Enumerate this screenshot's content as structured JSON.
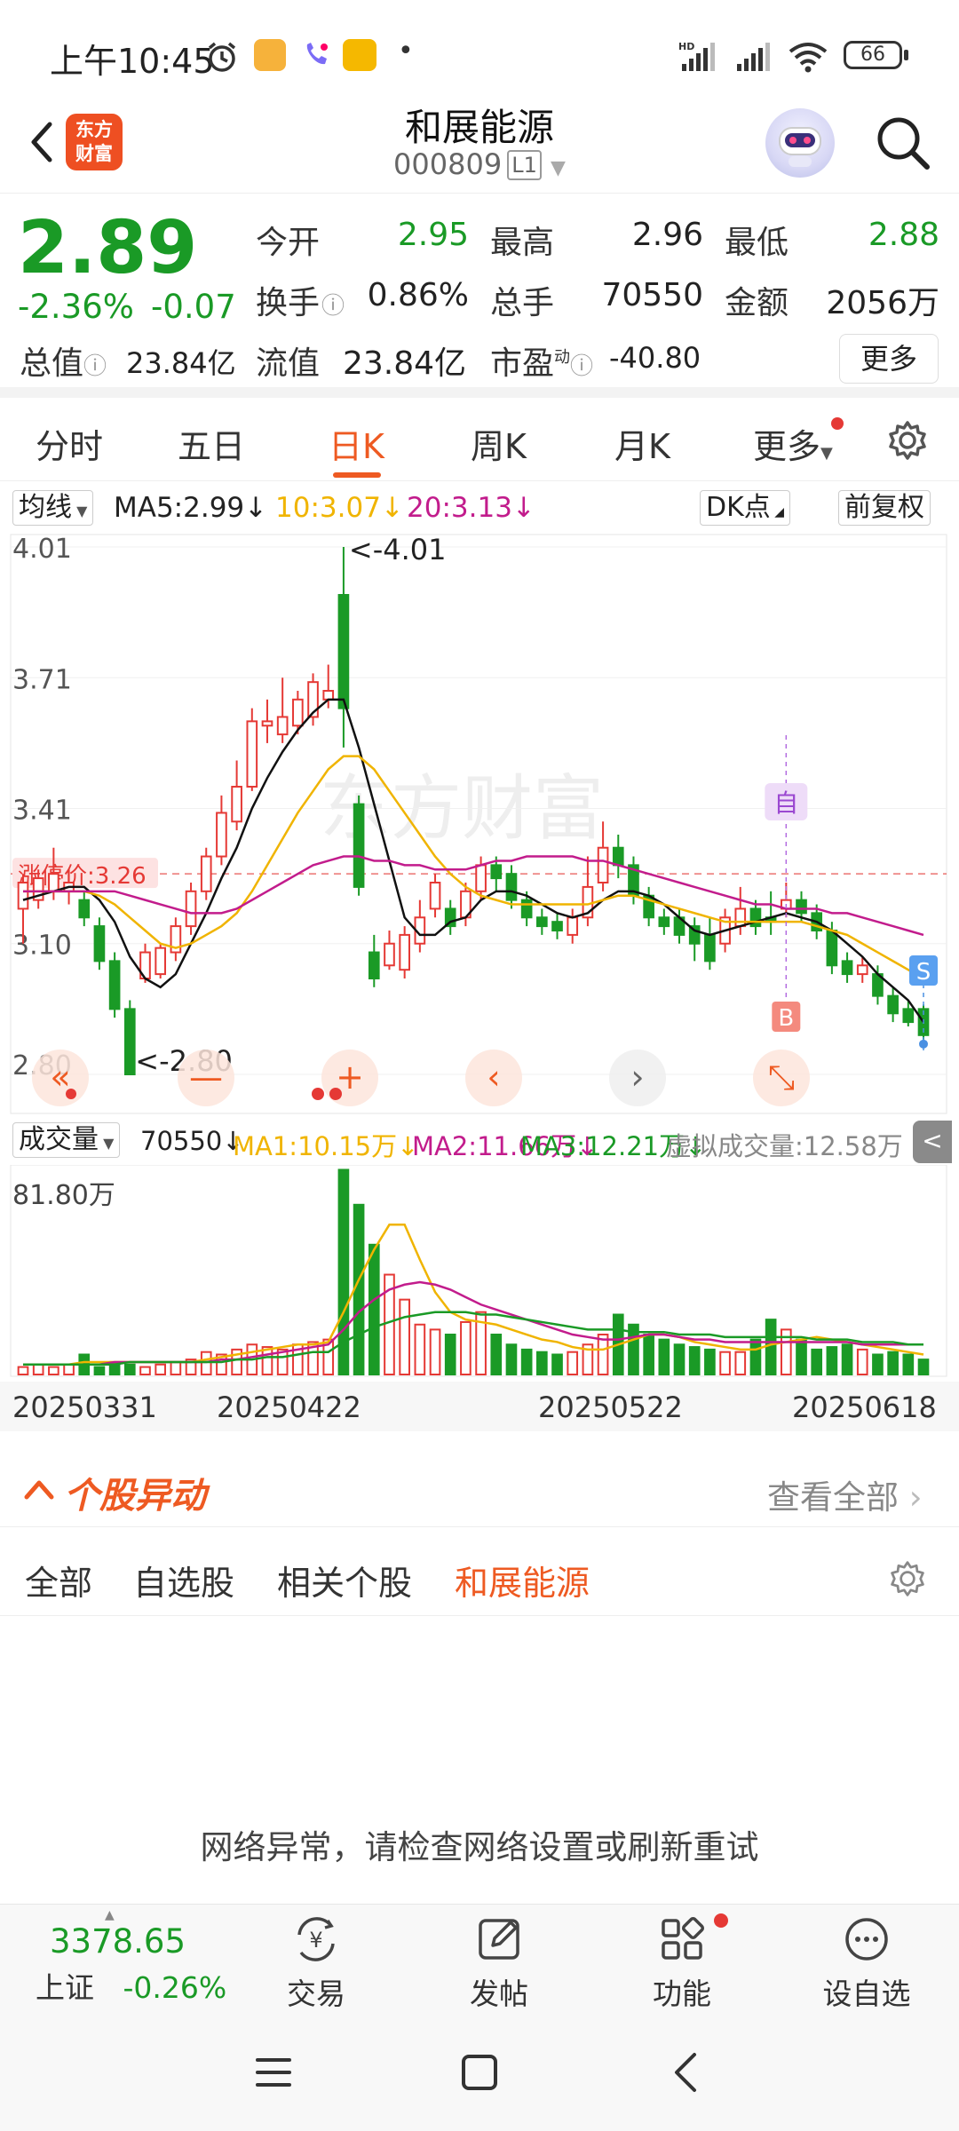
{
  "status_bar": {
    "time": "上午10:45",
    "battery": "66"
  },
  "header": {
    "back_icon": "chevron-left-icon",
    "logo_line1": "东方",
    "logo_line2": "财富",
    "stock_name": "和展能源",
    "stock_code": "000809",
    "level_badge": "L1",
    "search_icon": "search-icon"
  },
  "quote": {
    "price": "2.89",
    "change_pct": "-2.36%",
    "change_amt": "-0.07",
    "open_label": "今开",
    "open": "2.95",
    "high_label": "最高",
    "high": "2.96",
    "low_label": "最低",
    "low": "2.88",
    "turnover_label": "换手",
    "turnover": "0.86%",
    "volume_label": "总手",
    "volume": "70550",
    "amount_label": "金额",
    "amount": "2056万",
    "mktcap_label": "总值",
    "mktcap": "23.84亿",
    "float_label": "流值",
    "float": "23.84亿",
    "pe_label": "市盈",
    "pe_sup": "动",
    "pe": "-40.80",
    "more_label": "更多"
  },
  "tabs": [
    "分时",
    "五日",
    "日K",
    "周K",
    "月K",
    "更多"
  ],
  "active_tab": "日K",
  "ma_bar": {
    "selector": "均线",
    "ma5": "MA5:2.99",
    "ma10": "10:3.07",
    "ma20": "20:3.13",
    "dk_label": "DK点",
    "adjust_label": "前复权"
  },
  "kchart_labels": {
    "y_ticks": [
      "4.01",
      "3.71",
      "3.41",
      "3.10",
      "2.80"
    ],
    "max_marker": "<-4.01",
    "min_marker": "<-2.80",
    "limit_up_label": "涨停价:3.26",
    "self_marker": "自",
    "buy_marker": "B",
    "sell_marker": "S",
    "watermark": "东方财富"
  },
  "volume_bar": {
    "selector": "成交量",
    "vol": "70550",
    "ma1": "MA1:10.15万",
    "ma2": "MA2:11.66万",
    "ma3": "MA3:12.21万",
    "virtual": "虚拟成交量:12.58万",
    "y_max": "81.80万"
  },
  "dates": [
    "20250331",
    "20250422",
    "20250522",
    "20250618"
  ],
  "movers": {
    "title": "个股异动",
    "view_all": "查看全部",
    "tabs": [
      "全部",
      "自选股",
      "相关个股",
      "和展能源"
    ],
    "active_tab": "和展能源"
  },
  "network_message": "网络异常，请检查网络设置或刷新重试",
  "bottom_nav": {
    "index_value": "3378.65",
    "index_name": "上证",
    "index_change": "-0.26%",
    "items": [
      "交易",
      "发帖",
      "功能",
      "设自选"
    ]
  },
  "colors": {
    "up": "#e53935",
    "down": "#1a9a26",
    "accent": "#ee5a22",
    "ma5": "#111111",
    "ma10": "#f0b400",
    "ma20": "#c21c8c"
  },
  "chart_data": {
    "type": "candlestick",
    "y_range": [
      2.8,
      4.01
    ],
    "candles": [
      {
        "o": 3.18,
        "c": 3.24,
        "h": 3.26,
        "l": 3.1
      },
      {
        "o": 3.2,
        "c": 3.25,
        "h": 3.27,
        "l": 3.18
      },
      {
        "o": 3.22,
        "c": 3.26,
        "h": 3.32,
        "l": 3.2
      },
      {
        "o": 3.22,
        "c": 3.24,
        "h": 3.27,
        "l": 3.19
      },
      {
        "o": 3.2,
        "c": 3.16,
        "h": 3.22,
        "l": 3.14
      },
      {
        "o": 3.14,
        "c": 3.06,
        "h": 3.16,
        "l": 3.04
      },
      {
        "o": 3.06,
        "c": 2.95,
        "h": 3.08,
        "l": 2.93
      },
      {
        "o": 2.95,
        "c": 2.8,
        "h": 2.97,
        "l": 2.8
      },
      {
        "o": 3.02,
        "c": 3.08,
        "h": 3.1,
        "l": 3.01
      },
      {
        "o": 3.03,
        "c": 3.09,
        "h": 3.1,
        "l": 3.02
      },
      {
        "o": 3.08,
        "c": 3.14,
        "h": 3.16,
        "l": 3.06
      },
      {
        "o": 3.14,
        "c": 3.22,
        "h": 3.24,
        "l": 3.12
      },
      {
        "o": 3.22,
        "c": 3.3,
        "h": 3.32,
        "l": 3.2
      },
      {
        "o": 3.3,
        "c": 3.4,
        "h": 3.44,
        "l": 3.28
      },
      {
        "o": 3.38,
        "c": 3.46,
        "h": 3.52,
        "l": 3.36
      },
      {
        "o": 3.46,
        "c": 3.61,
        "h": 3.64,
        "l": 3.45
      },
      {
        "o": 3.6,
        "c": 3.61,
        "h": 3.66,
        "l": 3.56
      },
      {
        "o": 3.58,
        "c": 3.62,
        "h": 3.71,
        "l": 3.56
      },
      {
        "o": 3.6,
        "c": 3.66,
        "h": 3.68,
        "l": 3.58
      },
      {
        "o": 3.62,
        "c": 3.7,
        "h": 3.72,
        "l": 3.6
      },
      {
        "o": 3.66,
        "c": 3.68,
        "h": 3.74,
        "l": 3.64
      },
      {
        "o": 3.9,
        "c": 3.64,
        "h": 4.01,
        "l": 3.55
      },
      {
        "o": 3.42,
        "c": 3.23,
        "h": 3.44,
        "l": 3.21
      },
      {
        "o": 3.08,
        "c": 3.02,
        "h": 3.12,
        "l": 3.0
      },
      {
        "o": 3.05,
        "c": 3.1,
        "h": 3.13,
        "l": 3.04
      },
      {
        "o": 3.04,
        "c": 3.12,
        "h": 3.14,
        "l": 3.02
      },
      {
        "o": 3.1,
        "c": 3.16,
        "h": 3.2,
        "l": 3.08
      },
      {
        "o": 3.18,
        "c": 3.24,
        "h": 3.26,
        "l": 3.16
      },
      {
        "o": 3.18,
        "c": 3.14,
        "h": 3.2,
        "l": 3.12
      },
      {
        "o": 3.16,
        "c": 3.22,
        "h": 3.24,
        "l": 3.14
      },
      {
        "o": 3.22,
        "c": 3.28,
        "h": 3.3,
        "l": 3.2
      },
      {
        "o": 3.28,
        "c": 3.25,
        "h": 3.3,
        "l": 3.22
      },
      {
        "o": 3.26,
        "c": 3.2,
        "h": 3.28,
        "l": 3.18
      },
      {
        "o": 3.2,
        "c": 3.16,
        "h": 3.22,
        "l": 3.14
      },
      {
        "o": 3.16,
        "c": 3.14,
        "h": 3.18,
        "l": 3.12
      },
      {
        "o": 3.15,
        "c": 3.13,
        "h": 3.17,
        "l": 3.11
      },
      {
        "o": 3.12,
        "c": 3.16,
        "h": 3.18,
        "l": 3.1
      },
      {
        "o": 3.16,
        "c": 3.23,
        "h": 3.3,
        "l": 3.14
      },
      {
        "o": 3.24,
        "c": 3.32,
        "h": 3.38,
        "l": 3.22
      },
      {
        "o": 3.32,
        "c": 3.28,
        "h": 3.35,
        "l": 3.25
      },
      {
        "o": 3.28,
        "c": 3.21,
        "h": 3.3,
        "l": 3.19
      },
      {
        "o": 3.21,
        "c": 3.16,
        "h": 3.23,
        "l": 3.14
      },
      {
        "o": 3.16,
        "c": 3.14,
        "h": 3.18,
        "l": 3.12
      },
      {
        "o": 3.16,
        "c": 3.12,
        "h": 3.18,
        "l": 3.1
      },
      {
        "o": 3.14,
        "c": 3.1,
        "h": 3.16,
        "l": 3.06
      },
      {
        "o": 3.12,
        "c": 3.06,
        "h": 3.16,
        "l": 3.04
      },
      {
        "o": 3.1,
        "c": 3.16,
        "h": 3.18,
        "l": 3.08
      },
      {
        "o": 3.14,
        "c": 3.18,
        "h": 3.23,
        "l": 3.12
      },
      {
        "o": 3.18,
        "c": 3.14,
        "h": 3.2,
        "l": 3.12
      },
      {
        "o": 3.16,
        "c": 3.15,
        "h": 3.22,
        "l": 3.12
      },
      {
        "o": 3.18,
        "c": 3.2,
        "h": 3.24,
        "l": 3.16
      },
      {
        "o": 3.2,
        "c": 3.17,
        "h": 3.22,
        "l": 3.15
      },
      {
        "o": 3.17,
        "c": 3.13,
        "h": 3.19,
        "l": 3.11
      },
      {
        "o": 3.13,
        "c": 3.05,
        "h": 3.15,
        "l": 3.03
      },
      {
        "o": 3.06,
        "c": 3.03,
        "h": 3.08,
        "l": 3.01
      },
      {
        "o": 3.03,
        "c": 3.05,
        "h": 3.07,
        "l": 3.01
      },
      {
        "o": 3.03,
        "c": 2.98,
        "h": 3.05,
        "l": 2.96
      },
      {
        "o": 2.98,
        "c": 2.94,
        "h": 3.0,
        "l": 2.92
      },
      {
        "o": 2.95,
        "c": 2.92,
        "h": 2.97,
        "l": 2.91
      },
      {
        "o": 2.95,
        "c": 2.89,
        "h": 2.96,
        "l": 2.88
      }
    ],
    "ma5": [
      3.2,
      3.21,
      3.22,
      3.23,
      3.23,
      3.2,
      3.15,
      3.07,
      3.02,
      3.0,
      3.03,
      3.1,
      3.17,
      3.25,
      3.32,
      3.41,
      3.48,
      3.54,
      3.59,
      3.63,
      3.66,
      3.66,
      3.55,
      3.42,
      3.29,
      3.16,
      3.12,
      3.12,
      3.15,
      3.16,
      3.2,
      3.22,
      3.22,
      3.21,
      3.19,
      3.17,
      3.16,
      3.17,
      3.2,
      3.22,
      3.22,
      3.21,
      3.19,
      3.16,
      3.13,
      3.12,
      3.13,
      3.14,
      3.15,
      3.16,
      3.17,
      3.16,
      3.15,
      3.13,
      3.1,
      3.07,
      3.03,
      3.0,
      2.97,
      2.92
    ],
    "ma10": [
      3.22,
      3.22,
      3.22,
      3.22,
      3.22,
      3.21,
      3.19,
      3.16,
      3.13,
      3.1,
      3.09,
      3.1,
      3.12,
      3.14,
      3.17,
      3.22,
      3.28,
      3.34,
      3.4,
      3.45,
      3.5,
      3.53,
      3.53,
      3.5,
      3.45,
      3.4,
      3.35,
      3.3,
      3.26,
      3.23,
      3.21,
      3.2,
      3.19,
      3.19,
      3.19,
      3.19,
      3.19,
      3.19,
      3.2,
      3.21,
      3.21,
      3.2,
      3.19,
      3.18,
      3.17,
      3.16,
      3.15,
      3.15,
      3.15,
      3.15,
      3.15,
      3.15,
      3.14,
      3.13,
      3.12,
      3.1,
      3.08,
      3.06,
      3.04,
      3.02
    ],
    "ma20": [
      3.22,
      3.22,
      3.22,
      3.22,
      3.22,
      3.22,
      3.22,
      3.21,
      3.2,
      3.19,
      3.18,
      3.17,
      3.17,
      3.17,
      3.18,
      3.2,
      3.22,
      3.24,
      3.26,
      3.28,
      3.29,
      3.3,
      3.3,
      3.29,
      3.29,
      3.28,
      3.28,
      3.27,
      3.27,
      3.27,
      3.28,
      3.29,
      3.29,
      3.3,
      3.3,
      3.3,
      3.3,
      3.29,
      3.29,
      3.28,
      3.27,
      3.26,
      3.25,
      3.24,
      3.23,
      3.22,
      3.21,
      3.2,
      3.19,
      3.19,
      3.18,
      3.18,
      3.18,
      3.17,
      3.17,
      3.16,
      3.15,
      3.14,
      3.13,
      3.12
    ],
    "volume": {
      "y_max": 81.8,
      "values": [
        3,
        4,
        3,
        4,
        8,
        3,
        5,
        4,
        3,
        4,
        5,
        6,
        9,
        8,
        10,
        12,
        11,
        10,
        12,
        13,
        14,
        82,
        68,
        52,
        40,
        30,
        20,
        18,
        16,
        21,
        25,
        16,
        12,
        10,
        9,
        8,
        9,
        12,
        16,
        24,
        20,
        16,
        14,
        12,
        11,
        10,
        9,
        9,
        14,
        22,
        18,
        14,
        10,
        11,
        12,
        10,
        8,
        9,
        8,
        6
      ],
      "ma1": [
        4,
        4,
        4,
        4,
        5,
        5,
        5,
        5,
        5,
        5,
        5,
        5,
        6,
        7,
        8,
        9,
        10,
        11,
        12,
        12,
        13,
        25,
        38,
        50,
        60,
        60,
        46,
        33,
        25,
        22,
        21,
        20,
        18,
        16,
        14,
        13,
        11,
        10,
        10,
        12,
        14,
        16,
        16,
        15,
        13,
        12,
        11,
        10,
        10,
        12,
        13,
        14,
        15,
        14,
        13,
        12,
        11,
        10,
        9,
        8
      ],
      "ma2": [
        4,
        4,
        4,
        4,
        4,
        4,
        5,
        5,
        5,
        5,
        5,
        5,
        5,
        6,
        6,
        7,
        8,
        9,
        10,
        11,
        12,
        18,
        25,
        30,
        34,
        36,
        37,
        36,
        34,
        31,
        28,
        26,
        24,
        22,
        20,
        18,
        16,
        15,
        14,
        14,
        15,
        16,
        16,
        15,
        14,
        14,
        13,
        13,
        13,
        13,
        13,
        13,
        13,
        13,
        13,
        12,
        12,
        12,
        12,
        12
      ],
      "ma3": [
        4,
        4,
        4,
        4,
        4,
        4,
        4,
        5,
        5,
        5,
        5,
        5,
        5,
        5,
        6,
        6,
        7,
        7,
        8,
        9,
        9,
        13,
        16,
        19,
        21,
        23,
        24,
        25,
        25,
        25,
        24,
        24,
        23,
        22,
        21,
        20,
        19,
        18,
        18,
        18,
        17,
        17,
        17,
        16,
        16,
        16,
        15,
        15,
        15,
        15,
        15,
        15,
        14,
        14,
        14,
        13,
        13,
        13,
        12,
        12
      ]
    }
  }
}
